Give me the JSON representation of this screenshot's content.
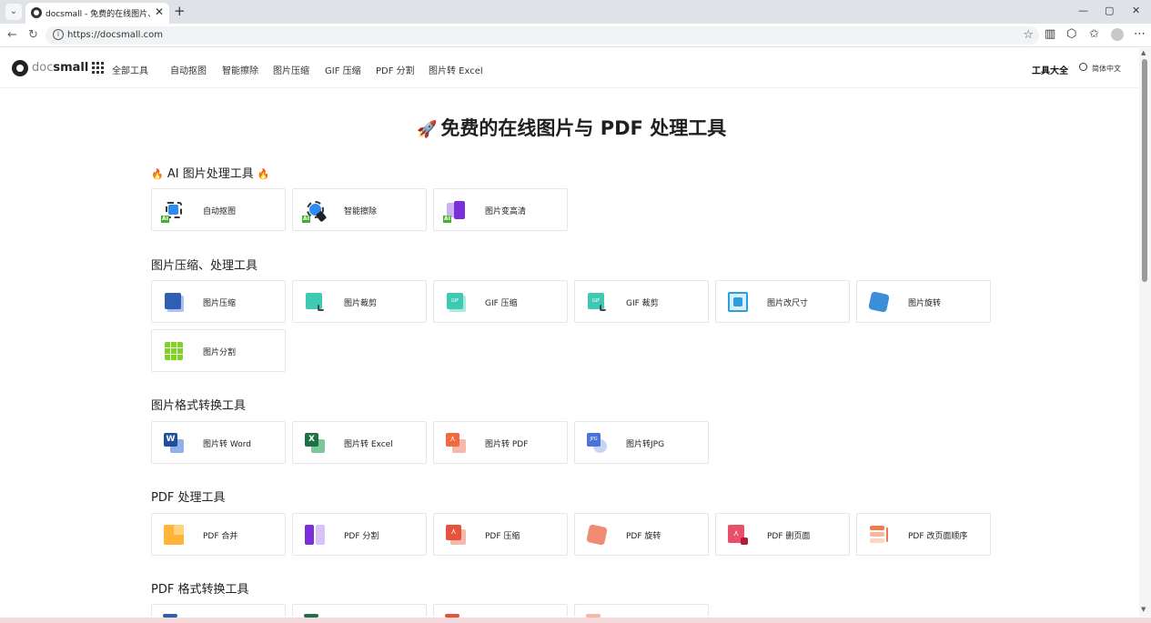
{
  "browser": {
    "tab_title": "docsmall - 免费的在线图片、PDF处",
    "url": "https://docsmall.com",
    "tab_close": "✕",
    "new_tab": "+",
    "min": "—",
    "restore": "▢",
    "close": "✕"
  },
  "header": {
    "logo_doc": "doc",
    "logo_small": "small",
    "all_tools": "全部工具",
    "nav": [
      "自动抠图",
      "智能擦除",
      "图片压缩",
      "GIF 压缩",
      "PDF 分割",
      "图片转 Excel"
    ],
    "tools_all": "工具大全",
    "language": "简体中文"
  },
  "page_title": "免费的在线图片与 PDF 处理工具",
  "sections": {
    "ai": {
      "title": "AI 图片处理工具",
      "cards": [
        "自动抠图",
        "智能擦除",
        "图片变高清"
      ]
    },
    "image": {
      "title": "图片压缩、处理工具",
      "cards": [
        "图片压缩",
        "图片裁剪",
        "GIF 压缩",
        "GIF 裁剪",
        "图片改尺寸",
        "图片旋转",
        "图片分割"
      ]
    },
    "convert": {
      "title": "图片格式转换工具",
      "cards": [
        "图片转 Word",
        "图片转 Excel",
        "图片转 PDF",
        "图片转JPG"
      ]
    },
    "pdf": {
      "title": "PDF 处理工具",
      "cards": [
        "PDF 合并",
        "PDF 分割",
        "PDF 压缩",
        "PDF 旋转",
        "PDF 删页面",
        "PDF 改页面顺序"
      ]
    },
    "pdfconvert": {
      "title": "PDF 格式转换工具"
    }
  },
  "icon_texts": {
    "ai": "AI",
    "gif": "GIF",
    "word": "W",
    "excel": "X",
    "jpg": "JPG"
  },
  "colors": {
    "accent_blue": "#2d8cf0",
    "excel_green": "#1e7145",
    "pdf_red": "#e5533d",
    "gif_teal": "#3ec9b5",
    "purple": "#7a2fd8"
  }
}
